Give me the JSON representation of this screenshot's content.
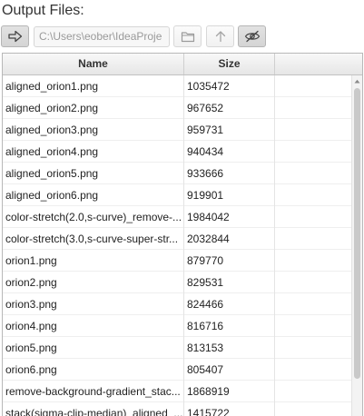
{
  "title": "Output Files:",
  "toolbar": {
    "go_icon": "arrow-right-icon",
    "path_value": "C:\\Users\\eober\\IdeaProje",
    "folder_icon": "folder-icon",
    "up_icon": "arrow-up-icon",
    "hidden_icon": "eye-slash-icon"
  },
  "table": {
    "columns": [
      "Name",
      "Size",
      ""
    ],
    "rows": [
      {
        "name": "aligned_orion1.png",
        "size": "1035472"
      },
      {
        "name": "aligned_orion2.png",
        "size": "967652"
      },
      {
        "name": "aligned_orion3.png",
        "size": "959731"
      },
      {
        "name": "aligned_orion4.png",
        "size": "940434"
      },
      {
        "name": "aligned_orion5.png",
        "size": "933666"
      },
      {
        "name": "aligned_orion6.png",
        "size": "919901"
      },
      {
        "name": "color-stretch(2.0,s-curve)_remove-...",
        "size": "1984042"
      },
      {
        "name": "color-stretch(3.0,s-curve-super-str...",
        "size": "2032844"
      },
      {
        "name": "orion1.png",
        "size": "879770"
      },
      {
        "name": "orion2.png",
        "size": "829531"
      },
      {
        "name": "orion3.png",
        "size": "824466"
      },
      {
        "name": "orion4.png",
        "size": "816716"
      },
      {
        "name": "orion5.png",
        "size": "813153"
      },
      {
        "name": "orion6.png",
        "size": "805407"
      },
      {
        "name": "remove-background-gradient_stac...",
        "size": "1868919"
      },
      {
        "name": "stack(sigma-clip-median)_aligned_...",
        "size": "1415722"
      }
    ]
  },
  "colors": {
    "button_border": "#c7c7c7",
    "header_bg": "#e6e6e6",
    "grid_line": "#e4e4e4",
    "scroll_thumb": "#c9c9c9"
  }
}
